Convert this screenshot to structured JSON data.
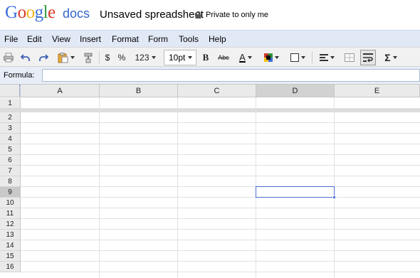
{
  "header": {
    "logo_letters": [
      {
        "ch": "G",
        "color": "#3b6fd8"
      },
      {
        "ch": "o",
        "color": "#d73a27"
      },
      {
        "ch": "o",
        "color": "#f3b21b"
      },
      {
        "ch": "g",
        "color": "#3b6fd8"
      },
      {
        "ch": "l",
        "color": "#2e9b3c"
      },
      {
        "ch": "e",
        "color": "#d73a27"
      }
    ],
    "docs_label": "docs",
    "title": "Unsaved spreadsheet",
    "privacy": "Private to only me"
  },
  "menu": [
    "File",
    "Edit",
    "View",
    "Insert",
    "Format",
    "Form",
    "Tools",
    "Help"
  ],
  "toolbar": {
    "currency": "$",
    "percent": "%",
    "number_format": "123",
    "font_size": "10pt",
    "bold": "B",
    "strike": "Abc",
    "text_color_letter": "A",
    "sum": "Σ"
  },
  "formula": {
    "label": "Formula:",
    "value": ""
  },
  "grid": {
    "columns": [
      "A",
      "B",
      "C",
      "D",
      "E"
    ],
    "selected_column": "D",
    "frozen_rows": [
      "1"
    ],
    "rows": [
      "2",
      "3",
      "4",
      "5",
      "6",
      "7",
      "8",
      "9",
      "10",
      "11",
      "12",
      "13",
      "14",
      "15",
      "16"
    ],
    "selected_row": "9",
    "active_cell": "D9"
  },
  "colors": {
    "menubar": "#e1e9f6",
    "selection": "#4a6fd2"
  }
}
